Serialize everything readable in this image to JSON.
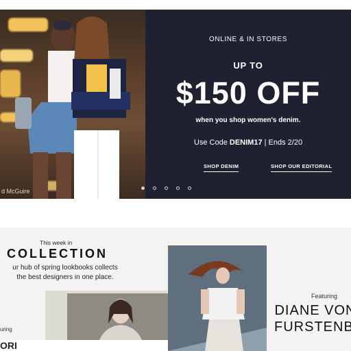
{
  "hero": {
    "photo_credit": "d McGuire",
    "eyebrow": "ONLINE & IN STORES",
    "up_to": "UP TO",
    "headline": "$150 OFF",
    "subhead": "when you shop women's denim.",
    "code_prefix": "Use Code",
    "code": "DENIM17",
    "code_suffix": "|  Ends 2/20",
    "cta_shop_denim": "SHOP DENIM",
    "cta_editorial": "SHOP OUR EDITORIAL",
    "dots_total": 5,
    "dots_active_index": 0
  },
  "collection_section": {
    "intro": "This week in",
    "title": "COLLECTION",
    "description_line1": "ur hub of spring lookbooks collects",
    "description_line2": "the best designers in one place.",
    "featuring_left": "uring",
    "bottom_text": "ORI",
    "featuring": "Featuring",
    "designer": "DIANE VON FURSTENBE"
  }
}
